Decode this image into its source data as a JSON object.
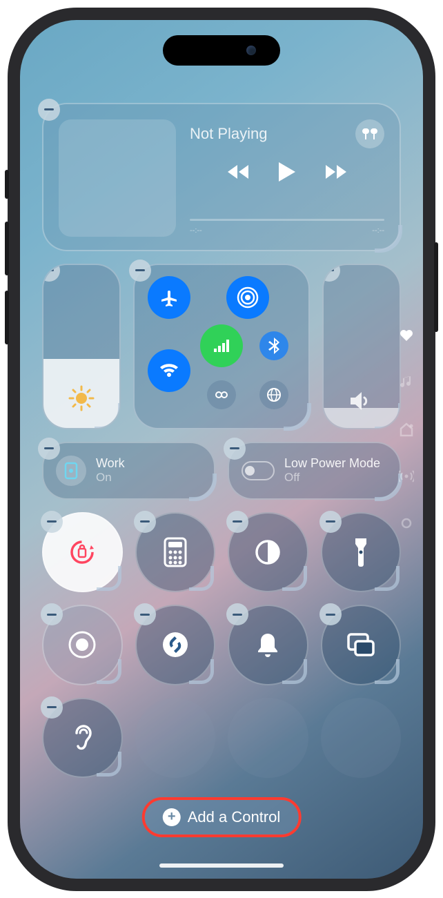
{
  "media": {
    "title": "Not Playing",
    "time_start": "--:--",
    "time_end": "--:--",
    "output_device": "airpods"
  },
  "connectivity": {
    "airplane": {
      "on": false
    },
    "airdrop": {
      "on": true
    },
    "wifi": {
      "on": true
    },
    "cellular": {
      "on": true
    },
    "bluetooth": {
      "on": true
    },
    "hotspot": {
      "on": false
    },
    "vpn": {
      "on": false
    }
  },
  "brightness": {
    "level_pct": 42
  },
  "volume": {
    "level_pct": 12
  },
  "focus": {
    "title": "Work",
    "status": "On"
  },
  "low_power": {
    "title": "Low Power Mode",
    "status": "Off"
  },
  "controls_row1": [
    {
      "name": "orientation-lock",
      "active": true
    },
    {
      "name": "calculator"
    },
    {
      "name": "dark-mode"
    },
    {
      "name": "flashlight"
    }
  ],
  "controls_row2": [
    {
      "name": "screen-record"
    },
    {
      "name": "shazam"
    },
    {
      "name": "silent-mode"
    },
    {
      "name": "screen-mirroring"
    }
  ],
  "controls_row3": [
    {
      "name": "hearing"
    },
    {
      "name": "empty"
    },
    {
      "name": "empty"
    },
    {
      "name": "empty"
    }
  ],
  "side_nav": [
    "favorites",
    "music",
    "home",
    "radio",
    "new-page"
  ],
  "add_control_label": "Add a Control",
  "annotation": "red-highlight-on-add-control"
}
